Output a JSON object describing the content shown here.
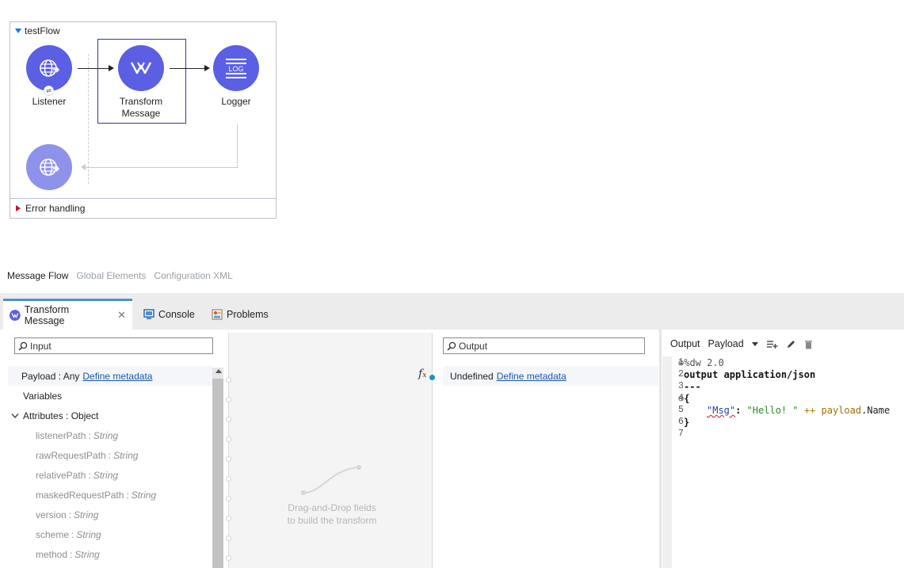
{
  "flow": {
    "title": "testFlow",
    "nodes": {
      "listener": "Listener",
      "transform_line1": "Transform",
      "transform_line2": "Message",
      "logger": "Logger",
      "logger_icon_text": "LOG"
    },
    "error_handling": "Error handling"
  },
  "view_tabs": {
    "message_flow": "Message Flow",
    "global_elements": "Global Elements",
    "configuration_xml": "Configuration XML"
  },
  "panel_tabs": {
    "transform": "Transform Message",
    "console": "Console",
    "problems": "Problems"
  },
  "input": {
    "search_placeholder": "Input",
    "payload_label": "Payload : Any ",
    "define_metadata": "Define metadata",
    "variables": "Variables",
    "attributes": "Attributes : Object",
    "fields": [
      {
        "name": "listenerPath",
        "type": "String"
      },
      {
        "name": "rawRequestPath",
        "type": "String"
      },
      {
        "name": "relativePath",
        "type": "String"
      },
      {
        "name": "maskedRequestPath",
        "type": "String"
      },
      {
        "name": "version",
        "type": "String"
      },
      {
        "name": "scheme",
        "type": "String"
      },
      {
        "name": "method",
        "type": "String"
      }
    ]
  },
  "mapping": {
    "hint_line1": "Drag-and-Drop fields",
    "hint_line2": "to build the transform"
  },
  "output": {
    "search_placeholder": "Output",
    "undefined": "Undefined ",
    "define_metadata": "Define metadata",
    "fx": "fx"
  },
  "code": {
    "toolbar_output": "Output",
    "toolbar_payload": "Payload",
    "lines": {
      "l1": {
        "num": "1",
        "text": "%dw 2.0"
      },
      "l2": {
        "num": "2",
        "text": "output application/json"
      },
      "l3": {
        "num": "3",
        "text": "---"
      },
      "l4": {
        "num": "4",
        "text": "{"
      },
      "l5": {
        "num": "5",
        "key": "\"Msg\"",
        "colon": ": ",
        "str": "\"Hello! \"",
        "op": " ++ ",
        "kw": "payload",
        "rest": ".Name"
      },
      "l6": {
        "num": "6",
        "text": "}"
      },
      "l7": {
        "num": "7",
        "text": ""
      }
    }
  },
  "colors": {
    "node": "#5b5fe3",
    "node_faded": "#8f92ea",
    "link": "#1a56a8",
    "accent_tab": "#4a90d9"
  }
}
